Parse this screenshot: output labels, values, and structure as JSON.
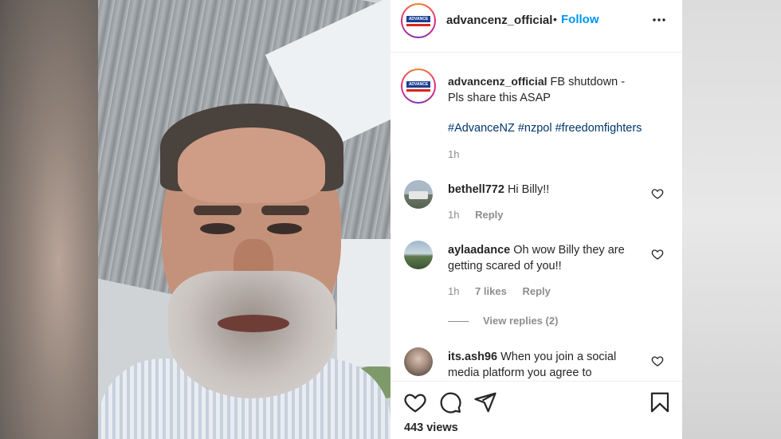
{
  "post": {
    "username": "advancenz_official",
    "separator": "•",
    "follow_label": "Follow",
    "more_label": "•••",
    "avatar_logo_text": "ADVANCE NZ"
  },
  "caption": {
    "username": "advancenz_official",
    "text": "FB shutdown - Pls share this ASAP",
    "hashtags": "#AdvanceNZ #nzpol #freedomfighters",
    "time": "1h"
  },
  "comments": [
    {
      "username": "bethell772",
      "text": "Hi Billy!!",
      "time": "1h",
      "likes": "",
      "reply_label": "Reply"
    },
    {
      "username": "aylaadance",
      "text": "Oh wow Billy they are getting scared of you!!",
      "time": "1h",
      "likes": "7 likes",
      "reply_label": "Reply",
      "view_replies": "View replies (2)"
    },
    {
      "username": "its.ash96",
      "text": "When you join a social media platform you agree to"
    }
  ],
  "footer": {
    "views": "443 views"
  },
  "icons": {
    "like": "heart-icon",
    "comment": "comment-icon",
    "share": "send-icon",
    "save": "bookmark-icon"
  },
  "colors": {
    "follow": "#0095f6",
    "hashtag": "#00376b",
    "text": "#262626",
    "muted": "#8e8e8e"
  }
}
